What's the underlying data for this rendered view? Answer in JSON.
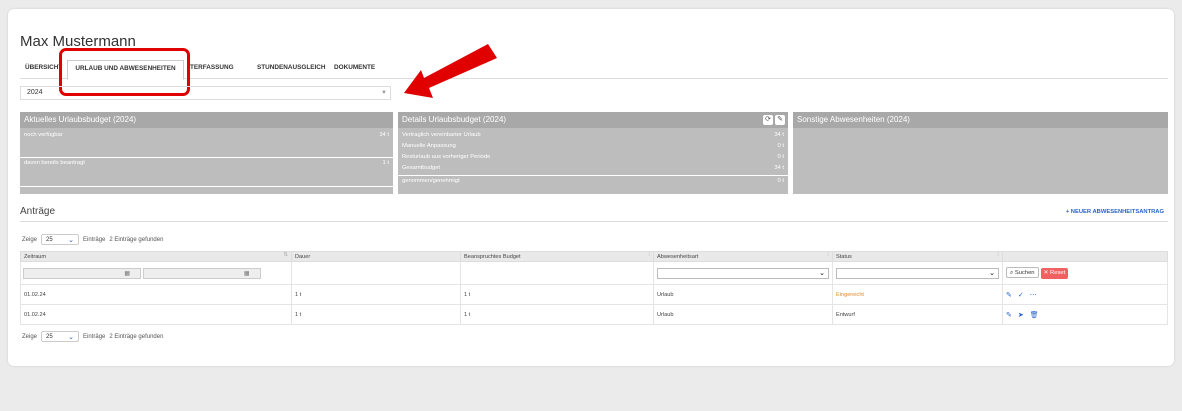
{
  "person": {
    "name": "Max Mustermann"
  },
  "tabs": [
    {
      "label": "ÜBERSICHT"
    },
    {
      "label": "URLAUB UND ABWESENHEITEN"
    },
    {
      "label": "ZEITERFASSUNG"
    },
    {
      "label": "STUNDENAUSGLEICH"
    },
    {
      "label": "DOKUMENTE"
    }
  ],
  "year_select": {
    "value": "2024"
  },
  "budget_current": {
    "title": "Aktuelles Urlaubsbudget (2024)",
    "rows": [
      {
        "label": "noch verfügbar",
        "value": "34 t"
      },
      {
        "label": "davon bereits beantragt",
        "value": "1 t"
      }
    ]
  },
  "budget_details": {
    "title": "Details Urlaubsbudget (2024)",
    "rows": [
      {
        "label": "Vertraglich vereinbarter Urlaub",
        "value": "34 t"
      },
      {
        "label": "Manuelle Anpassung",
        "value": "0 t"
      },
      {
        "label": "Resturlaub aus vorheriger Periode",
        "value": "0 t"
      },
      {
        "label": "Gesamtbudget",
        "value": "34 t"
      },
      {
        "label": "genommen/genehmigt",
        "value": "0 t"
      }
    ]
  },
  "other_absences": {
    "title": "Sonstige Abwesenheiten (2024)"
  },
  "requests": {
    "title": "Anträge",
    "new_button": "+ NEUER ABWESENHEITSANTRAG",
    "length": {
      "prefix": "Zeige",
      "value": "25",
      "suffix": "Einträge",
      "found": "2 Einträge gefunden"
    },
    "columns": [
      "Zeitraum",
      "Dauer",
      "Beanspruchtes Budget",
      "Abwesenheitsart",
      "Status",
      ""
    ],
    "search_label": "Suchen",
    "reset_label": "Reset",
    "rows": [
      {
        "period": "01.02.24",
        "duration": "1 t",
        "budget": "1 t",
        "type": "Urlaub",
        "status": "Eingereicht"
      },
      {
        "period": "01.02.24",
        "duration": "1 t",
        "budget": "1 t",
        "type": "Urlaub",
        "status": "Entwurf"
      }
    ]
  },
  "colors": {
    "accent": "#2a63c7",
    "highlight": "#e10000",
    "status_submitted": "#e08a2e"
  }
}
